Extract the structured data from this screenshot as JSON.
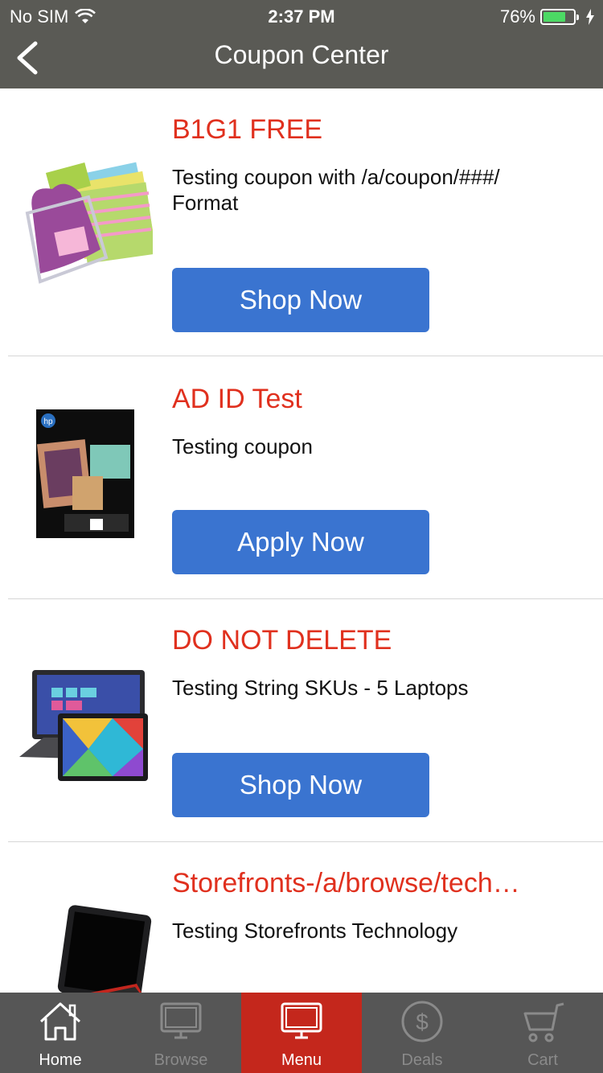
{
  "status_bar": {
    "carrier": "No SIM",
    "time": "2:37 PM",
    "battery_percent": "76%",
    "battery_level": 0.76
  },
  "nav": {
    "title": "Coupon Center",
    "back_icon": "chevron-left-icon"
  },
  "coupons": [
    {
      "title": "B1G1 FREE",
      "description": "Testing coupon with /a/coupon/###/ Format",
      "button_label": "Shop Now",
      "image": "sticky-notes-product-image"
    },
    {
      "title": "AD ID Test",
      "description": "Testing coupon",
      "button_label": "Apply Now",
      "image": "hp-brochure-paper-product-image"
    },
    {
      "title": "DO NOT DELETE",
      "description": "Testing String SKUs - 5 Laptops",
      "button_label": "Shop Now",
      "image": "laptop-tablet-product-image"
    },
    {
      "title": "Storefronts-/a/browse/tech…",
      "description": "Testing Storefronts Technology",
      "button_label": "",
      "image": "tablet-keyboard-case-product-image"
    }
  ],
  "tabs": [
    {
      "label": "Home",
      "icon": "home-icon",
      "state": "normal"
    },
    {
      "label": "Browse",
      "icon": "monitor-icon",
      "state": "dim"
    },
    {
      "label": "Menu",
      "icon": "monitor-icon",
      "state": "active"
    },
    {
      "label": "Deals",
      "icon": "dollar-icon",
      "state": "dim"
    },
    {
      "label": "Cart",
      "icon": "cart-icon",
      "state": "dim"
    }
  ],
  "colors": {
    "nav_bg": "#5a5a55",
    "title_red": "#e0301e",
    "button_blue": "#3a74d0",
    "tab_active": "#c4271c",
    "tab_bg": "#565656"
  }
}
